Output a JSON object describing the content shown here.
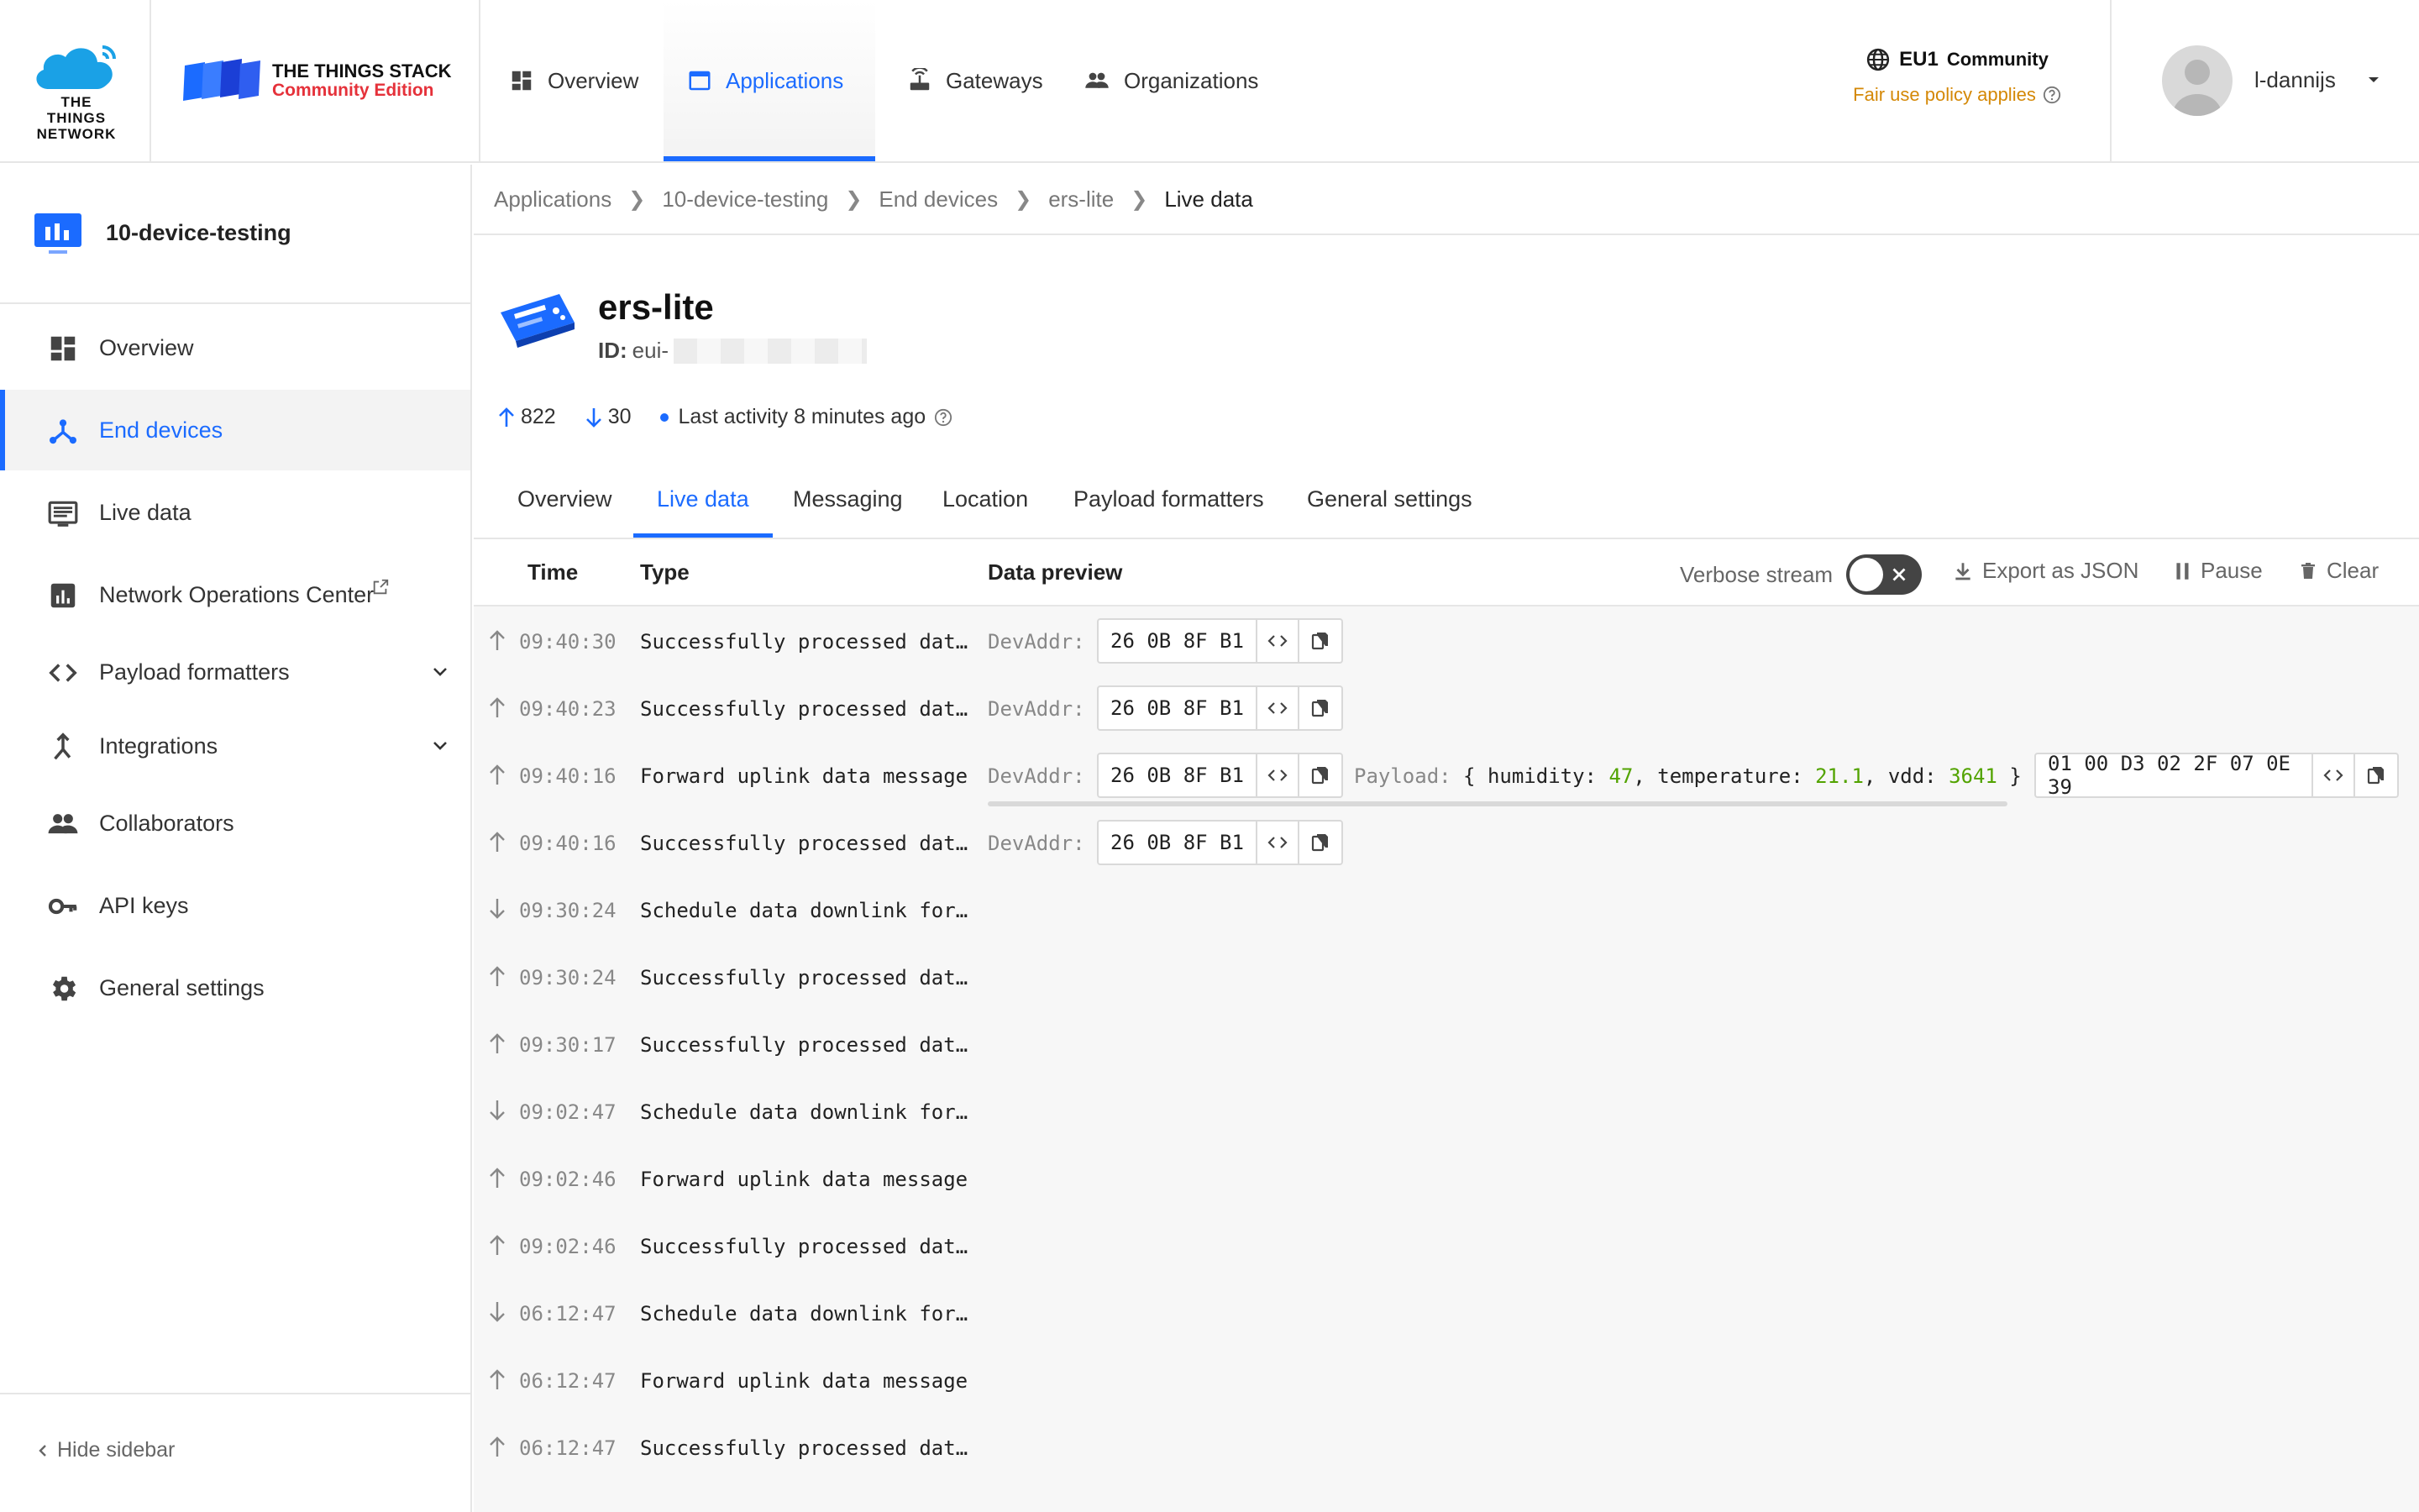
{
  "header": {
    "ttn_logo_text": "THE THINGS NETWORK",
    "stack_logo_line1": "THE THINGS STACK",
    "stack_logo_line2": "Community Edition",
    "nav": [
      {
        "label": "Overview",
        "icon": "dashboard-icon"
      },
      {
        "label": "Applications",
        "icon": "window-icon",
        "active": true
      },
      {
        "label": "Gateways",
        "icon": "gateway-icon"
      },
      {
        "label": "Organizations",
        "icon": "people-icon"
      }
    ],
    "cluster_name": "EU1",
    "cluster_suffix": "Community",
    "fair_use": "Fair use policy applies",
    "username": "l-dannijs",
    "accent": "#1b6bff",
    "warning_color": "#d48806"
  },
  "sidebar": {
    "app_name": "10-device-testing",
    "items": [
      {
        "label": "Overview",
        "icon": "dashboard-icon"
      },
      {
        "label": "End devices",
        "icon": "device-tree-icon",
        "active": true
      },
      {
        "label": "Live data",
        "icon": "list-icon"
      },
      {
        "label": "Network Operations Center",
        "icon": "chart-icon"
      },
      {
        "label": "Payload formatters",
        "icon": "code-icon"
      },
      {
        "label": "Integrations",
        "icon": "merge-icon"
      },
      {
        "label": "Collaborators",
        "icon": "people-icon"
      },
      {
        "label": "API keys",
        "icon": "key-icon"
      },
      {
        "label": "General settings",
        "icon": "gear-icon"
      }
    ],
    "hide_label": "Hide sidebar"
  },
  "breadcrumb": [
    "Applications",
    "10-device-testing",
    "End devices",
    "ers-lite",
    "Live data"
  ],
  "device": {
    "name": "ers-lite",
    "id_label": "ID:",
    "id_value": "eui-",
    "uplinks": "822",
    "downlinks": "30",
    "last_activity": "Last activity 8 minutes ago"
  },
  "tabs": [
    "Overview",
    "Live data",
    "Messaging",
    "Location",
    "Payload formatters",
    "General settings"
  ],
  "live": {
    "col_time": "Time",
    "col_type": "Type",
    "col_preview": "Data preview",
    "verbose_label": "Verbose stream",
    "export_label": "Export as JSON",
    "pause_label": "Pause",
    "clear_label": "Clear",
    "devaddr_label": "DevAddr:",
    "devaddr_value": "26 0B 8F B1",
    "payload_label": "Payload:",
    "payload_open": "{",
    "payload_close": "}",
    "payload_fields": [
      {
        "key": "humidity:",
        "value": "47",
        "sep": ","
      },
      {
        "key": "temperature:",
        "value": "21.1",
        "sep": ","
      },
      {
        "key": "vdd:",
        "value": "3641",
        "sep": ""
      }
    ],
    "payload_hex": "01 00 D3 02 2F 07 0E 39",
    "rows": [
      {
        "dir": "up",
        "time": "09:40:30",
        "type": "Successfully processed data message",
        "devaddr": true
      },
      {
        "dir": "up",
        "time": "09:40:23",
        "type": "Successfully processed data message",
        "devaddr": true
      },
      {
        "dir": "up",
        "time": "09:40:16",
        "type": "Forward uplink data message",
        "devaddr": true,
        "payload": true
      },
      {
        "dir": "up",
        "time": "09:40:16",
        "type": "Successfully processed data message",
        "devaddr": true
      },
      {
        "dir": "down",
        "time": "09:30:24",
        "type": "Schedule data downlink for transmission"
      },
      {
        "dir": "up",
        "time": "09:30:24",
        "type": "Successfully processed data message"
      },
      {
        "dir": "up",
        "time": "09:30:17",
        "type": "Successfully processed data message"
      },
      {
        "dir": "down",
        "time": "09:02:47",
        "type": "Schedule data downlink for transmission"
      },
      {
        "dir": "up",
        "time": "09:02:46",
        "type": "Forward uplink data message"
      },
      {
        "dir": "up",
        "time": "09:02:46",
        "type": "Successfully processed data message"
      },
      {
        "dir": "down",
        "time": "06:12:47",
        "type": "Schedule data downlink for transmission"
      },
      {
        "dir": "up",
        "time": "06:12:47",
        "type": "Forward uplink data message"
      },
      {
        "dir": "up",
        "time": "06:12:47",
        "type": "Successfully processed data message"
      }
    ]
  }
}
